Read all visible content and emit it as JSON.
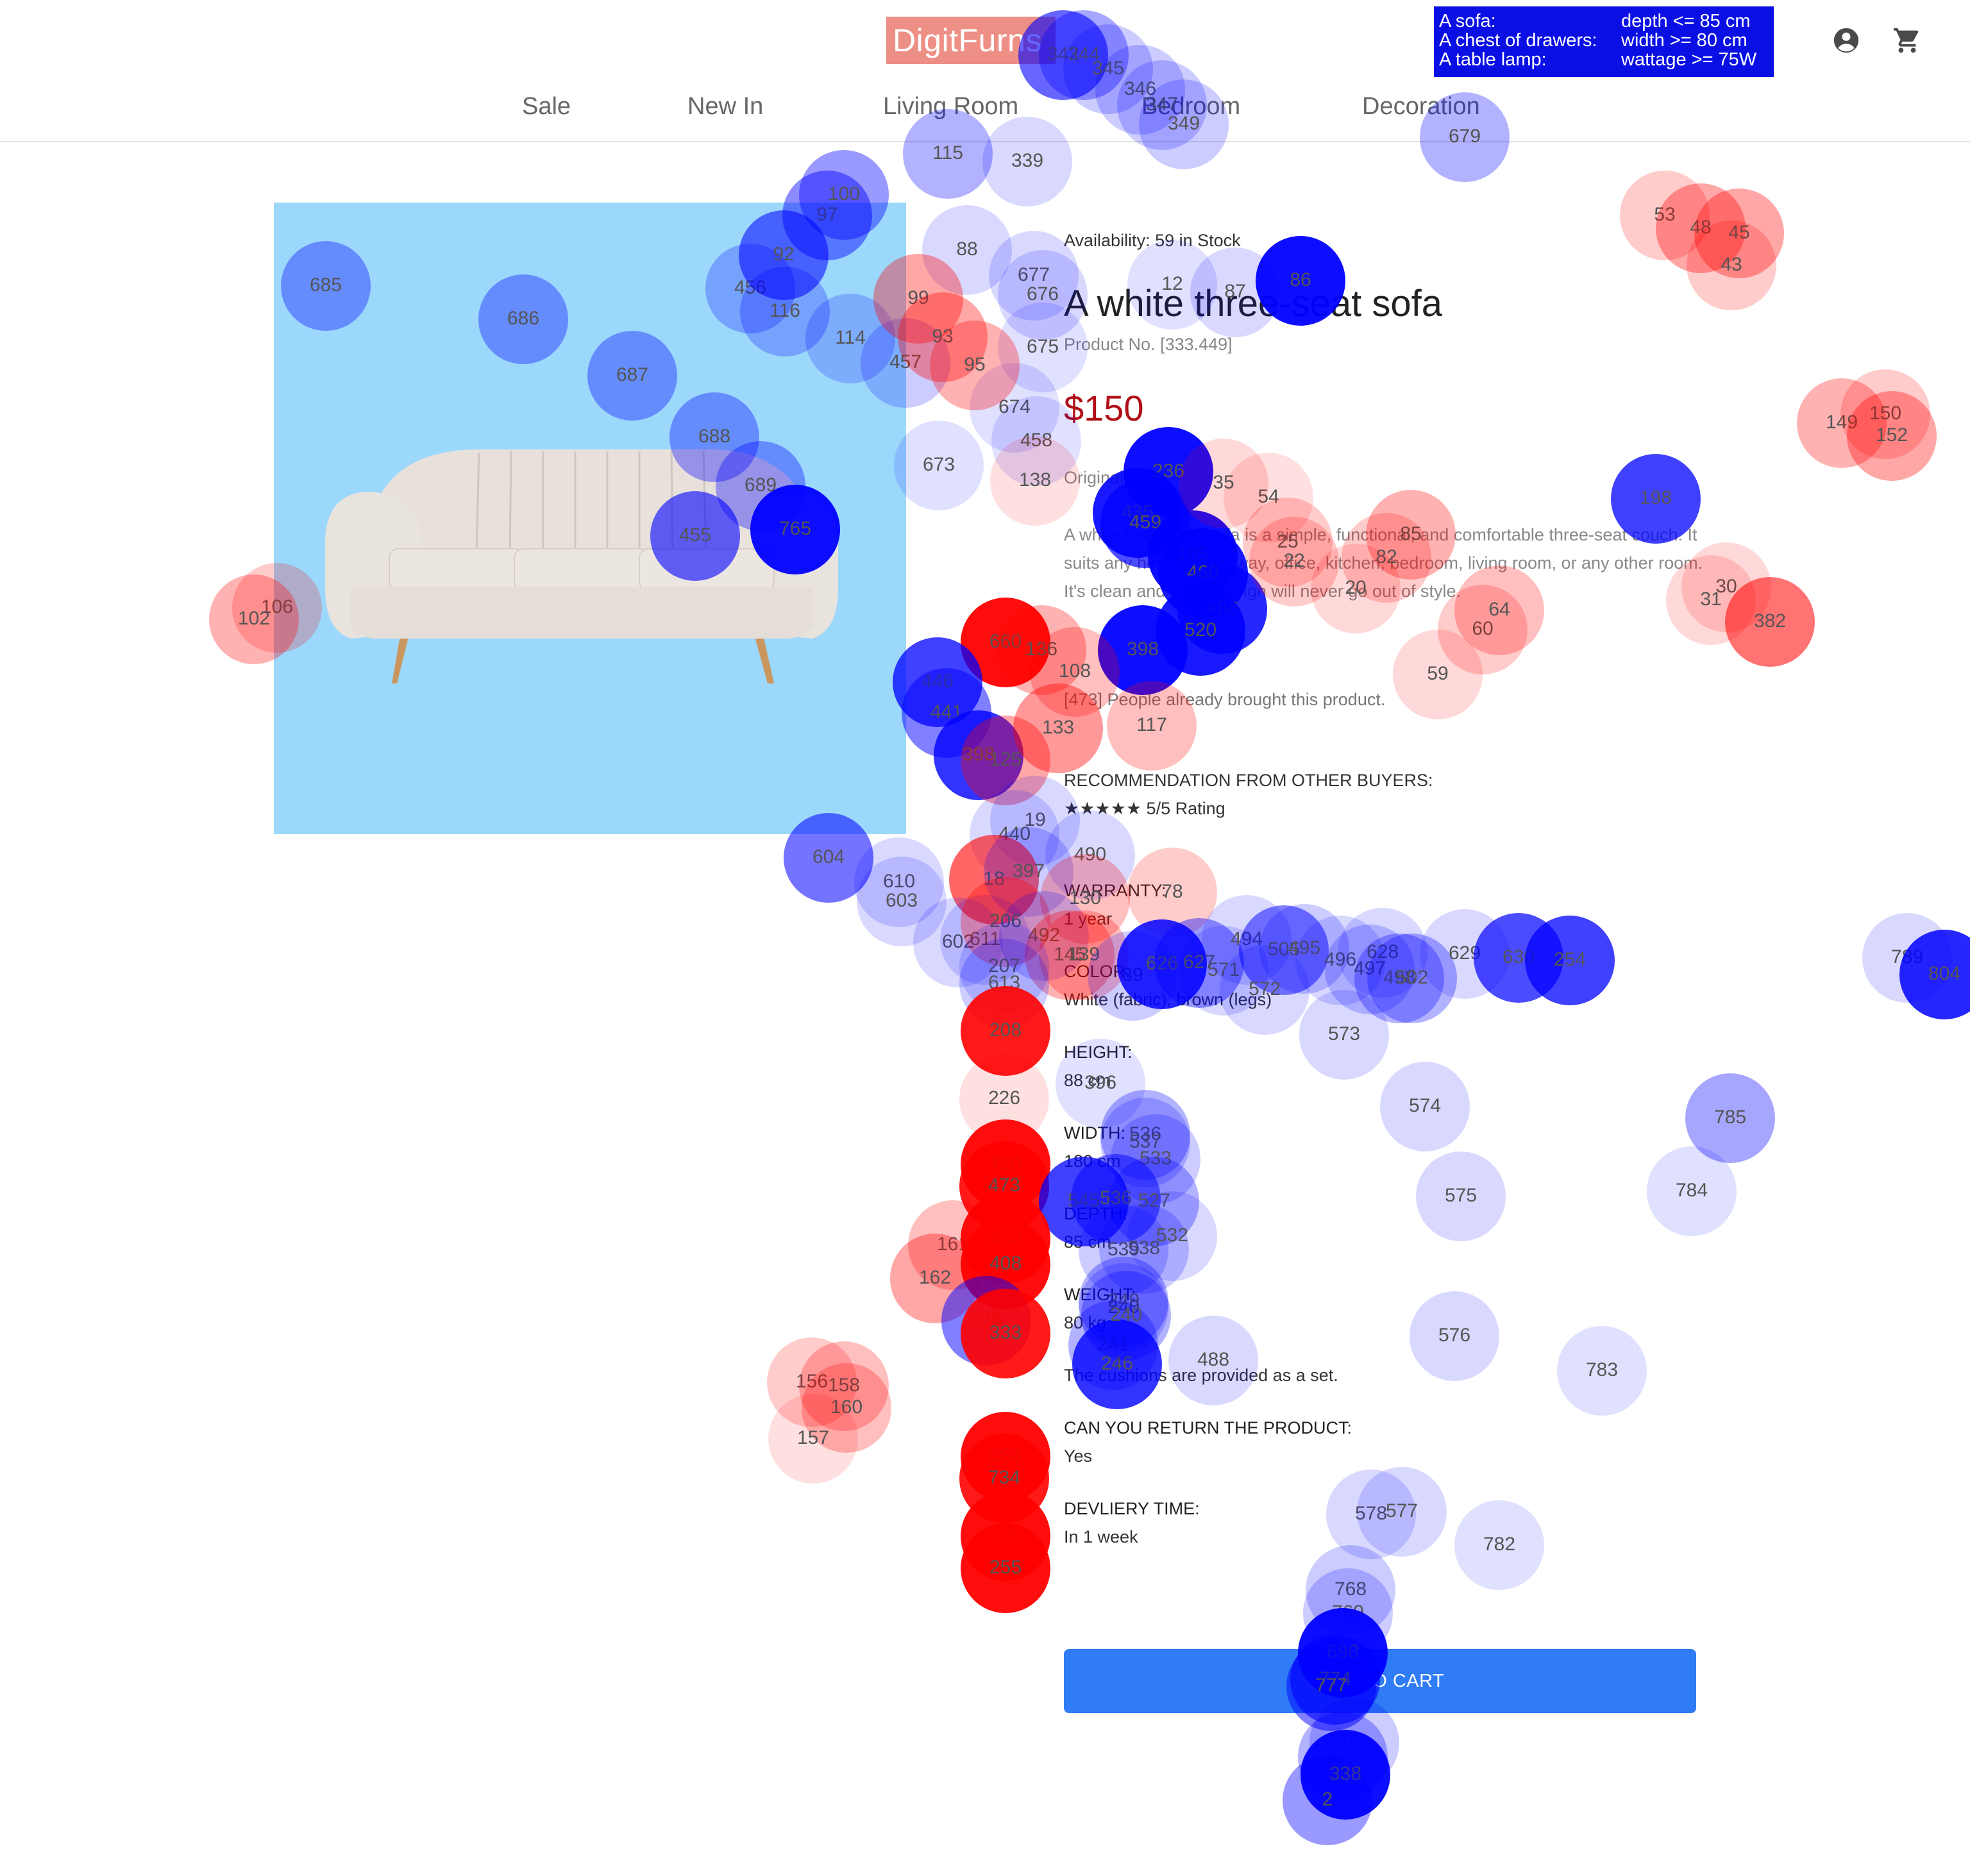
{
  "header": {
    "logo": "DigitFurns",
    "task": [
      {
        "item": "A sofa:",
        "condition": "depth <= 85 cm"
      },
      {
        "item": "A chest of drawers:",
        "condition": "width >= 80 cm"
      },
      {
        "item": "A table lamp:",
        "condition": "wattage >= 75W"
      }
    ],
    "account_icon": "account-circle-icon",
    "cart_icon": "shopping-cart-icon"
  },
  "nav": [
    "Sale",
    "New In",
    "Living Room",
    "Bedroom",
    "Decoration"
  ],
  "product": {
    "availability": "Availability: 59 in Stock",
    "title": "A white three-seat sofa",
    "product_no": "Product No. [333.449]",
    "price": "$150",
    "original": "Original",
    "description": "A white three-seat sofa is a simple, functional, and comfortable three-seat couch. It suits any home's entryway, office, kitchen, bedroom, living room, or any other room. It's clean and sleek design will never go out of style.",
    "bought": "[473] People already brought this product.",
    "recommendation_label": "RECOMMENDATION FROM OTHER BUYERS:",
    "rating_stars": "★★★★★",
    "rating_text": "5/5 Rating",
    "specs": [
      {
        "label": "WARRANTY:",
        "value": "1 year"
      },
      {
        "label": "COLOR:",
        "value": "White (fabric), brown (legs)"
      },
      {
        "label": "HEIGHT:",
        "value": "88 cm"
      },
      {
        "label": "WIDTH:",
        "value": "180 cm"
      },
      {
        "label": "DEPTH:",
        "value": "85 cm"
      },
      {
        "label": "WEIGHT:",
        "value": "80 kg"
      }
    ],
    "cushions_note": "The cushions are provided as a set.",
    "return_label": "CAN YOU RETURN THE PRODUCT:",
    "return_value": "Yes",
    "delivery_label": "DEVLIERY TIME:",
    "delivery_value": "In 1 week",
    "cart_button": "ADD TO CART"
  },
  "colors": {
    "left_eye": "#ff0000",
    "right_eye": "#0000ff",
    "accent_button": "#2f7cf6",
    "price": "#b10f17"
  },
  "gaze_fixations": [
    {
      "n": "685",
      "c": "b",
      "o": 0.35
    },
    {
      "n": "686",
      "c": "b",
      "o": 0.35
    },
    {
      "n": "687",
      "c": "b",
      "o": 0.35
    },
    {
      "n": "688",
      "c": "b",
      "o": 0.35
    },
    {
      "n": "689",
      "c": "b",
      "o": 0.35
    },
    {
      "n": "765",
      "c": "b",
      "o": 0.95
    },
    {
      "n": "455",
      "c": "b",
      "o": 0.6
    },
    {
      "n": "456",
      "c": "b",
      "o": 0.25
    },
    {
      "n": "116",
      "c": "b",
      "o": 0.25
    },
    {
      "n": "114",
      "c": "b",
      "o": 0.2
    },
    {
      "n": "457",
      "c": "b",
      "o": 0.2
    },
    {
      "n": "92",
      "c": "b",
      "o": 0.55
    },
    {
      "n": "97",
      "c": "b",
      "o": 0.45
    },
    {
      "n": "100",
      "c": "b",
      "o": 0.4
    },
    {
      "n": "115",
      "c": "b",
      "o": 0.3
    },
    {
      "n": "339",
      "c": "b",
      "o": 0.15
    },
    {
      "n": "342",
      "c": "b",
      "o": 0.6
    },
    {
      "n": "344",
      "c": "b",
      "o": 0.35
    },
    {
      "n": "345",
      "c": "b",
      "o": 0.2
    },
    {
      "n": "346",
      "c": "b",
      "o": 0.2
    },
    {
      "n": "347",
      "c": "b",
      "o": 0.2
    },
    {
      "n": "349",
      "c": "b",
      "o": 0.2
    },
    {
      "n": "679",
      "c": "b",
      "o": 0.3
    },
    {
      "n": "88",
      "c": "b",
      "o": 0.15
    },
    {
      "n": "677",
      "c": "b",
      "o": 0.15
    },
    {
      "n": "676",
      "c": "b",
      "o": 0.15
    },
    {
      "n": "675",
      "c": "b",
      "o": 0.12
    },
    {
      "n": "674",
      "c": "b",
      "o": 0.12
    },
    {
      "n": "673",
      "c": "b",
      "o": 0.12
    },
    {
      "n": "458",
      "c": "b",
      "o": 0.12
    },
    {
      "n": "12",
      "c": "b",
      "o": 0.12
    },
    {
      "n": "87",
      "c": "b",
      "o": 0.15
    },
    {
      "n": "86",
      "c": "b",
      "o": 0.95
    },
    {
      "n": "99",
      "c": "r",
      "o": 0.35
    },
    {
      "n": "93",
      "c": "r",
      "o": 0.35
    },
    {
      "n": "95",
      "c": "r",
      "o": 0.3
    },
    {
      "n": "138",
      "c": "r",
      "o": 0.12
    },
    {
      "n": "236",
      "c": "b",
      "o": 0.95
    },
    {
      "n": "435",
      "c": "b",
      "o": 0.9
    },
    {
      "n": "459",
      "c": "b",
      "o": 0.7
    },
    {
      "n": "185",
      "c": "b",
      "o": 0.95
    },
    {
      "n": "460",
      "c": "b",
      "o": 0.9
    },
    {
      "n": "486",
      "c": "b",
      "o": 0.85
    },
    {
      "n": "520",
      "c": "b",
      "o": 0.9
    },
    {
      "n": "398",
      "c": "b",
      "o": 0.95
    },
    {
      "n": "54",
      "c": "r",
      "o": 0.12
    },
    {
      "n": "35",
      "c": "r",
      "o": 0.15
    },
    {
      "n": "25",
      "c": "r",
      "o": 0.2
    },
    {
      "n": "22",
      "c": "r",
      "o": 0.2
    },
    {
      "n": "85",
      "c": "r",
      "o": 0.3
    },
    {
      "n": "82",
      "c": "r",
      "o": 0.2
    },
    {
      "n": "20",
      "c": "r",
      "o": 0.15
    },
    {
      "n": "59",
      "c": "r",
      "o": 0.15
    },
    {
      "n": "60",
      "c": "r",
      "o": 0.2
    },
    {
      "n": "64",
      "c": "r",
      "o": 0.25
    },
    {
      "n": "53",
      "c": "r",
      "o": 0.2
    },
    {
      "n": "48",
      "c": "r",
      "o": 0.35
    },
    {
      "n": "45",
      "c": "r",
      "o": 0.35
    },
    {
      "n": "43",
      "c": "r",
      "o": 0.2
    },
    {
      "n": "149",
      "c": "r",
      "o": 0.3
    },
    {
      "n": "150",
      "c": "r",
      "o": 0.2
    },
    {
      "n": "152",
      "c": "r",
      "o": 0.35
    },
    {
      "n": "30",
      "c": "r",
      "o": 0.15
    },
    {
      "n": "31",
      "c": "r",
      "o": 0.15
    },
    {
      "n": "382",
      "c": "r",
      "o": 0.55
    },
    {
      "n": "198",
      "c": "b",
      "o": 0.75
    },
    {
      "n": "106",
      "c": "r",
      "o": 0.2
    },
    {
      "n": "102",
      "c": "r",
      "o": 0.3
    },
    {
      "n": "660",
      "c": "r",
      "o": 0.95
    },
    {
      "n": "136",
      "c": "r",
      "o": 0.3
    },
    {
      "n": "108",
      "c": "r",
      "o": 0.25
    },
    {
      "n": "446",
      "c": "b",
      "o": 0.75
    },
    {
      "n": "441",
      "c": "b",
      "o": 0.5
    },
    {
      "n": "398b",
      "c": "b",
      "o": 0.8
    },
    {
      "n": "125",
      "c": "r",
      "o": 0.35
    },
    {
      "n": "133",
      "c": "r",
      "o": 0.4
    },
    {
      "n": "117",
      "c": "r",
      "o": 0.25
    },
    {
      "n": "19",
      "c": "b",
      "o": 0.15
    },
    {
      "n": "440",
      "c": "b",
      "o": 0.15
    },
    {
      "n": "490",
      "c": "b",
      "o": 0.15
    },
    {
      "n": "604",
      "c": "b",
      "o": 0.55
    },
    {
      "n": "610",
      "c": "b",
      "o": 0.15
    },
    {
      "n": "603",
      "c": "b",
      "o": 0.15
    },
    {
      "n": "18",
      "c": "r",
      "o": 0.6
    },
    {
      "n": "397",
      "c": "b",
      "o": 0.2
    },
    {
      "n": "78",
      "c": "r",
      "o": 0.2
    },
    {
      "n": "130",
      "c": "r",
      "o": 0.25
    },
    {
      "n": "602",
      "c": "b",
      "o": 0.15
    },
    {
      "n": "611",
      "c": "b",
      "o": 0.15
    },
    {
      "n": "206",
      "c": "r",
      "o": 0.3
    },
    {
      "n": "492",
      "c": "b",
      "o": 0.2
    },
    {
      "n": "145",
      "c": "r",
      "o": 0.3
    },
    {
      "n": "139",
      "c": "r",
      "o": 0.25
    },
    {
      "n": "207",
      "c": "b",
      "o": 0.15
    },
    {
      "n": "613",
      "c": "b",
      "o": 0.2
    },
    {
      "n": "89",
      "c": "b",
      "o": 0.2
    },
    {
      "n": "626",
      "c": "b",
      "o": 0.85
    },
    {
      "n": "627",
      "c": "b",
      "o": 0.4
    },
    {
      "n": "571",
      "c": "b",
      "o": 0.15
    },
    {
      "n": "494",
      "c": "b",
      "o": 0.15
    },
    {
      "n": "505",
      "c": "b",
      "o": 0.5
    },
    {
      "n": "495",
      "c": "b",
      "o": 0.2
    },
    {
      "n": "496",
      "c": "b",
      "o": 0.15
    },
    {
      "n": "497",
      "c": "b",
      "o": 0.2
    },
    {
      "n": "628",
      "c": "b",
      "o": 0.15
    },
    {
      "n": "498",
      "c": "b",
      "o": 0.3
    },
    {
      "n": "502",
      "c": "b",
      "o": 0.3
    },
    {
      "n": "629",
      "c": "b",
      "o": 0.15
    },
    {
      "n": "630",
      "c": "b",
      "o": 0.7
    },
    {
      "n": "254",
      "c": "b",
      "o": 0.75
    },
    {
      "n": "572",
      "c": "b",
      "o": 0.15
    },
    {
      "n": "573",
      "c": "b",
      "o": 0.15
    },
    {
      "n": "789",
      "c": "b",
      "o": 0.15
    },
    {
      "n": "804",
      "c": "b",
      "o": 0.85
    },
    {
      "n": "208",
      "c": "r",
      "o": 0.9
    },
    {
      "n": "396",
      "c": "b",
      "o": 0.12
    },
    {
      "n": "226",
      "c": "r",
      "o": 0.12
    },
    {
      "n": "574",
      "c": "b",
      "o": 0.15
    },
    {
      "n": "785",
      "c": "b",
      "o": 0.35
    },
    {
      "n": "536",
      "c": "b",
      "o": 0.3
    },
    {
      "n": "537",
      "c": "b",
      "o": 0.2
    },
    {
      "n": "533",
      "c": "b",
      "o": 0.2
    },
    {
      "n": "575",
      "c": "b",
      "o": 0.15
    },
    {
      "n": "784",
      "c": "b",
      "o": 0.12
    },
    {
      "n": "720",
      "c": "r",
      "o": 0.95
    },
    {
      "n": "473",
      "c": "r",
      "o": 0.9
    },
    {
      "n": "545",
      "c": "b",
      "o": 0.75
    },
    {
      "n": "536b",
      "c": "b",
      "o": 0.5
    },
    {
      "n": "527",
      "c": "b",
      "o": 0.3
    },
    {
      "n": "161",
      "c": "r",
      "o": 0.25
    },
    {
      "n": "162",
      "c": "r",
      "o": 0.35
    },
    {
      "n": "480",
      "c": "r",
      "o": 0.95
    },
    {
      "n": "408",
      "c": "r",
      "o": 0.95
    },
    {
      "n": "539",
      "c": "b",
      "o": 0.2
    },
    {
      "n": "538",
      "c": "b",
      "o": 0.2
    },
    {
      "n": "532",
      "c": "b",
      "o": 0.15
    },
    {
      "n": "336",
      "c": "b",
      "o": 0.5
    },
    {
      "n": "333",
      "c": "r",
      "o": 0.9
    },
    {
      "n": "240",
      "c": "b",
      "o": 0.2
    },
    {
      "n": "249",
      "c": "b",
      "o": 0.3
    },
    {
      "n": "241",
      "c": "b",
      "o": 0.3
    },
    {
      "n": "246",
      "c": "b",
      "o": 0.8
    },
    {
      "n": "240b",
      "c": "b",
      "o": 0.3
    },
    {
      "n": "488",
      "c": "b",
      "o": 0.15
    },
    {
      "n": "576",
      "c": "b",
      "o": 0.15
    },
    {
      "n": "783",
      "c": "b",
      "o": 0.12
    },
    {
      "n": "156",
      "c": "r",
      "o": 0.2
    },
    {
      "n": "158",
      "c": "r",
      "o": 0.25
    },
    {
      "n": "160",
      "c": "r",
      "o": 0.25
    },
    {
      "n": "157",
      "c": "r",
      "o": 0.12
    },
    {
      "n": "686b",
      "c": "r",
      "o": 0.95
    },
    {
      "n": "734",
      "c": "r",
      "o": 0.9
    },
    {
      "n": "578",
      "c": "b",
      "o": 0.15
    },
    {
      "n": "577",
      "c": "b",
      "o": 0.15
    },
    {
      "n": "782",
      "c": "b",
      "o": 0.12
    },
    {
      "n": "700",
      "c": "r",
      "o": 0.95
    },
    {
      "n": "255",
      "c": "r",
      "o": 0.95
    },
    {
      "n": "768",
      "c": "b",
      "o": 0.2
    },
    {
      "n": "769",
      "c": "b",
      "o": 0.2
    },
    {
      "n": "698",
      "c": "b",
      "o": 0.95
    },
    {
      "n": "774",
      "c": "b",
      "o": 0.6
    },
    {
      "n": "777",
      "c": "b",
      "o": 0.5
    },
    {
      "n": "781",
      "c": "b",
      "o": 0.2
    },
    {
      "n": "778",
      "c": "b",
      "o": 0.3
    },
    {
      "n": "338",
      "c": "b",
      "o": 0.95
    },
    {
      "n": "2",
      "c": "b",
      "o": 0.4
    }
  ]
}
